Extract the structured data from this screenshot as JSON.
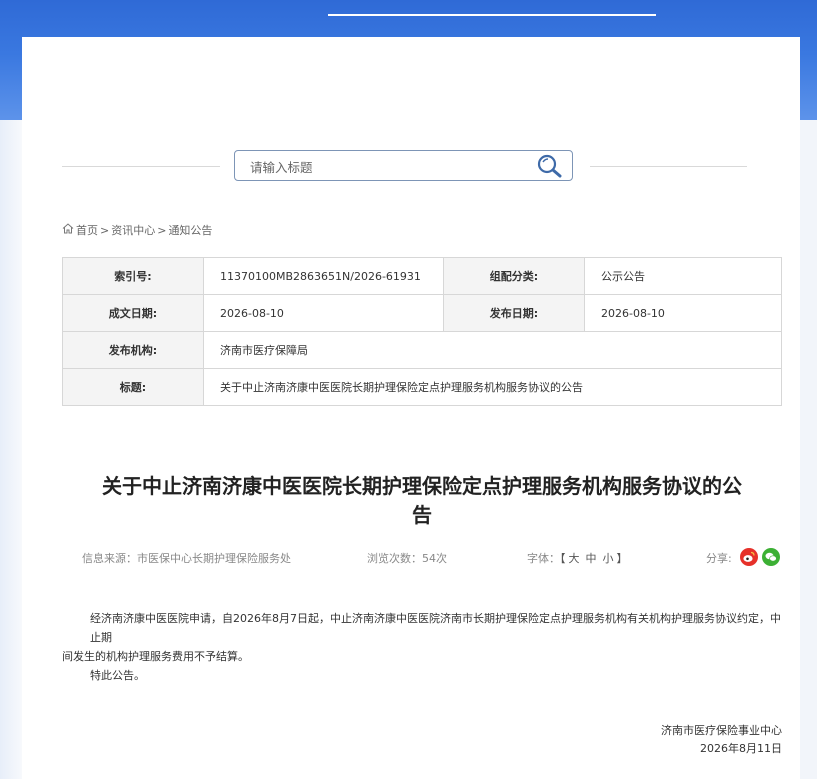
{
  "search": {
    "placeholder": "请输入标题"
  },
  "breadcrumb": {
    "home": "首页",
    "sep1": ">",
    "level1": "资讯中心",
    "sep2": ">",
    "level2": "通知公告"
  },
  "meta": {
    "index_label": "索引号:",
    "index_value": "11370100MB2863651N/2026-61931",
    "category_label": "组配分类:",
    "category_value": "公示公告",
    "created_label": "成文日期:",
    "created_value": "2026-08-10",
    "published_label": "发布日期:",
    "published_value": "2026-08-10",
    "agency_label": "发布机构:",
    "agency_value": "济南市医疗保障局",
    "title_label": "标题:",
    "title_value": "关于中止济南济康中医医院长期护理保险定点护理服务机构服务协议的公告"
  },
  "article": {
    "title_line1": "关于中止济南济康中医医院长期护理保险定点护理服务机构服务协议的公",
    "title_line2": "告",
    "source": "信息来源：市医保中心长期护理保险服务处",
    "views": "浏览次数：54次",
    "font_label": "字体：",
    "font_open": "【",
    "font_large": "大",
    "font_medium": "中",
    "font_small": "小",
    "font_close": "】",
    "share_label": "分享:",
    "para1_line1": "经济南济康中医医院申请，自2026年8月7日起，中止济南济康中医医院济南市长期护理保险定点护理服务机构有关机构护理服务协议约定，中止期",
    "para1_line2": "间发生的机构护理服务费用不予结算。",
    "para2": "特此公告。",
    "signer": "济南市医疗保险事业中心",
    "sign_date": "2026年8月11日"
  },
  "colors": {
    "banner": "#3a78e0",
    "weibo": "#e6312a",
    "wechat": "#3cb034",
    "search_border": "#7d95b6"
  },
  "icons": {
    "search": "search-icon",
    "home": "home-icon",
    "weibo": "weibo-icon",
    "wechat": "wechat-icon"
  }
}
